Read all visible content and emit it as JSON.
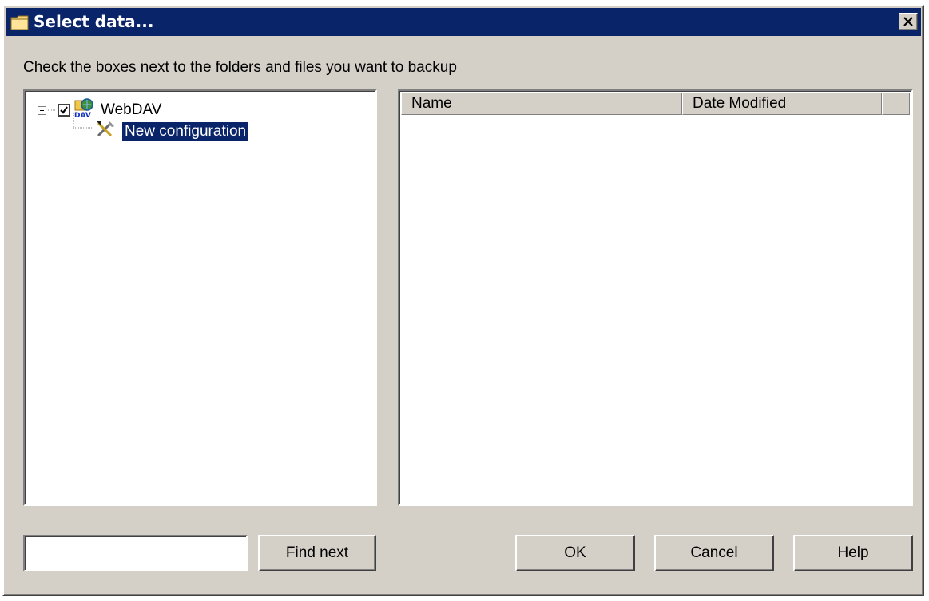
{
  "window": {
    "title": "Select data...",
    "icon": "folder-icon"
  },
  "instruction": "Check the boxes next to the folders and files you want to backup",
  "tree": {
    "root": {
      "label": "WebDAV",
      "checked": true,
      "expanded": true,
      "icon": "webdav-icon"
    },
    "child": {
      "label": "New configuration",
      "selected": true,
      "icon": "tools-icon"
    }
  },
  "file_list": {
    "columns": [
      "Name",
      "Date Modified",
      ""
    ]
  },
  "search": {
    "value": "",
    "placeholder": ""
  },
  "buttons": {
    "find_next": "Find next",
    "ok": "OK",
    "cancel": "Cancel",
    "help": "Help"
  },
  "colors": {
    "titlebar": "#0a246a",
    "face": "#d4d0c8",
    "selection": "#0a246a"
  }
}
